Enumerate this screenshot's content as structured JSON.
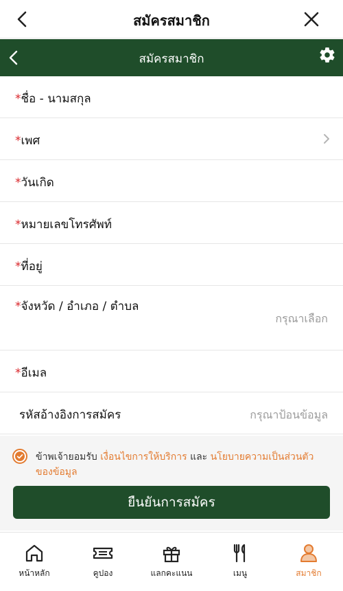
{
  "header": {
    "title": "สมัครสมาชิก"
  },
  "subheader": {
    "title": "สมัครสมาชิก"
  },
  "form": {
    "rows": [
      {
        "label": "ชื่อ - นามสกุล",
        "required": true,
        "hint": ""
      },
      {
        "label": "เพศ",
        "required": true,
        "hint": ""
      },
      {
        "label": "วันเกิด",
        "required": true,
        "hint": ""
      },
      {
        "label": "หมายเลขโทรศัพท์",
        "required": true,
        "hint": ""
      },
      {
        "label": "ที่อยู่",
        "required": true,
        "hint": ""
      },
      {
        "label": "จังหวัด / อำเภอ / ตำบล",
        "required": true,
        "hint": "กรุณาเลือก"
      },
      {
        "label": "อีเมล",
        "required": true,
        "hint": ""
      },
      {
        "label": "รหัสอ้างอิงการสมัคร",
        "required": false,
        "hint": "กรุณาป้อนข้อมูล"
      }
    ],
    "required_mark": "*"
  },
  "consent": {
    "checked": true,
    "prefix": "ข้าพเจ้ายอมรับ ",
    "link1": "เงื่อนไขการให้บริการ",
    "middle": " และ ",
    "link2": "นโยบายความเป็นส่วนตัวของข้อมูล"
  },
  "submit_label": "ยืนยันการสมัคร",
  "nav": {
    "items": [
      {
        "label": "หน้าหลัก",
        "icon": "home-icon"
      },
      {
        "label": "คูปอง",
        "icon": "ticket-icon"
      },
      {
        "label": "แลกคะแนน",
        "icon": "gift-icon"
      },
      {
        "label": "เมนู",
        "icon": "utensils-icon"
      },
      {
        "label": "สมาชิก",
        "icon": "person-icon",
        "active": true
      }
    ]
  },
  "colors": {
    "primary": "#1f4d2a",
    "accent": "#e37b30",
    "required": "#d9252a"
  }
}
